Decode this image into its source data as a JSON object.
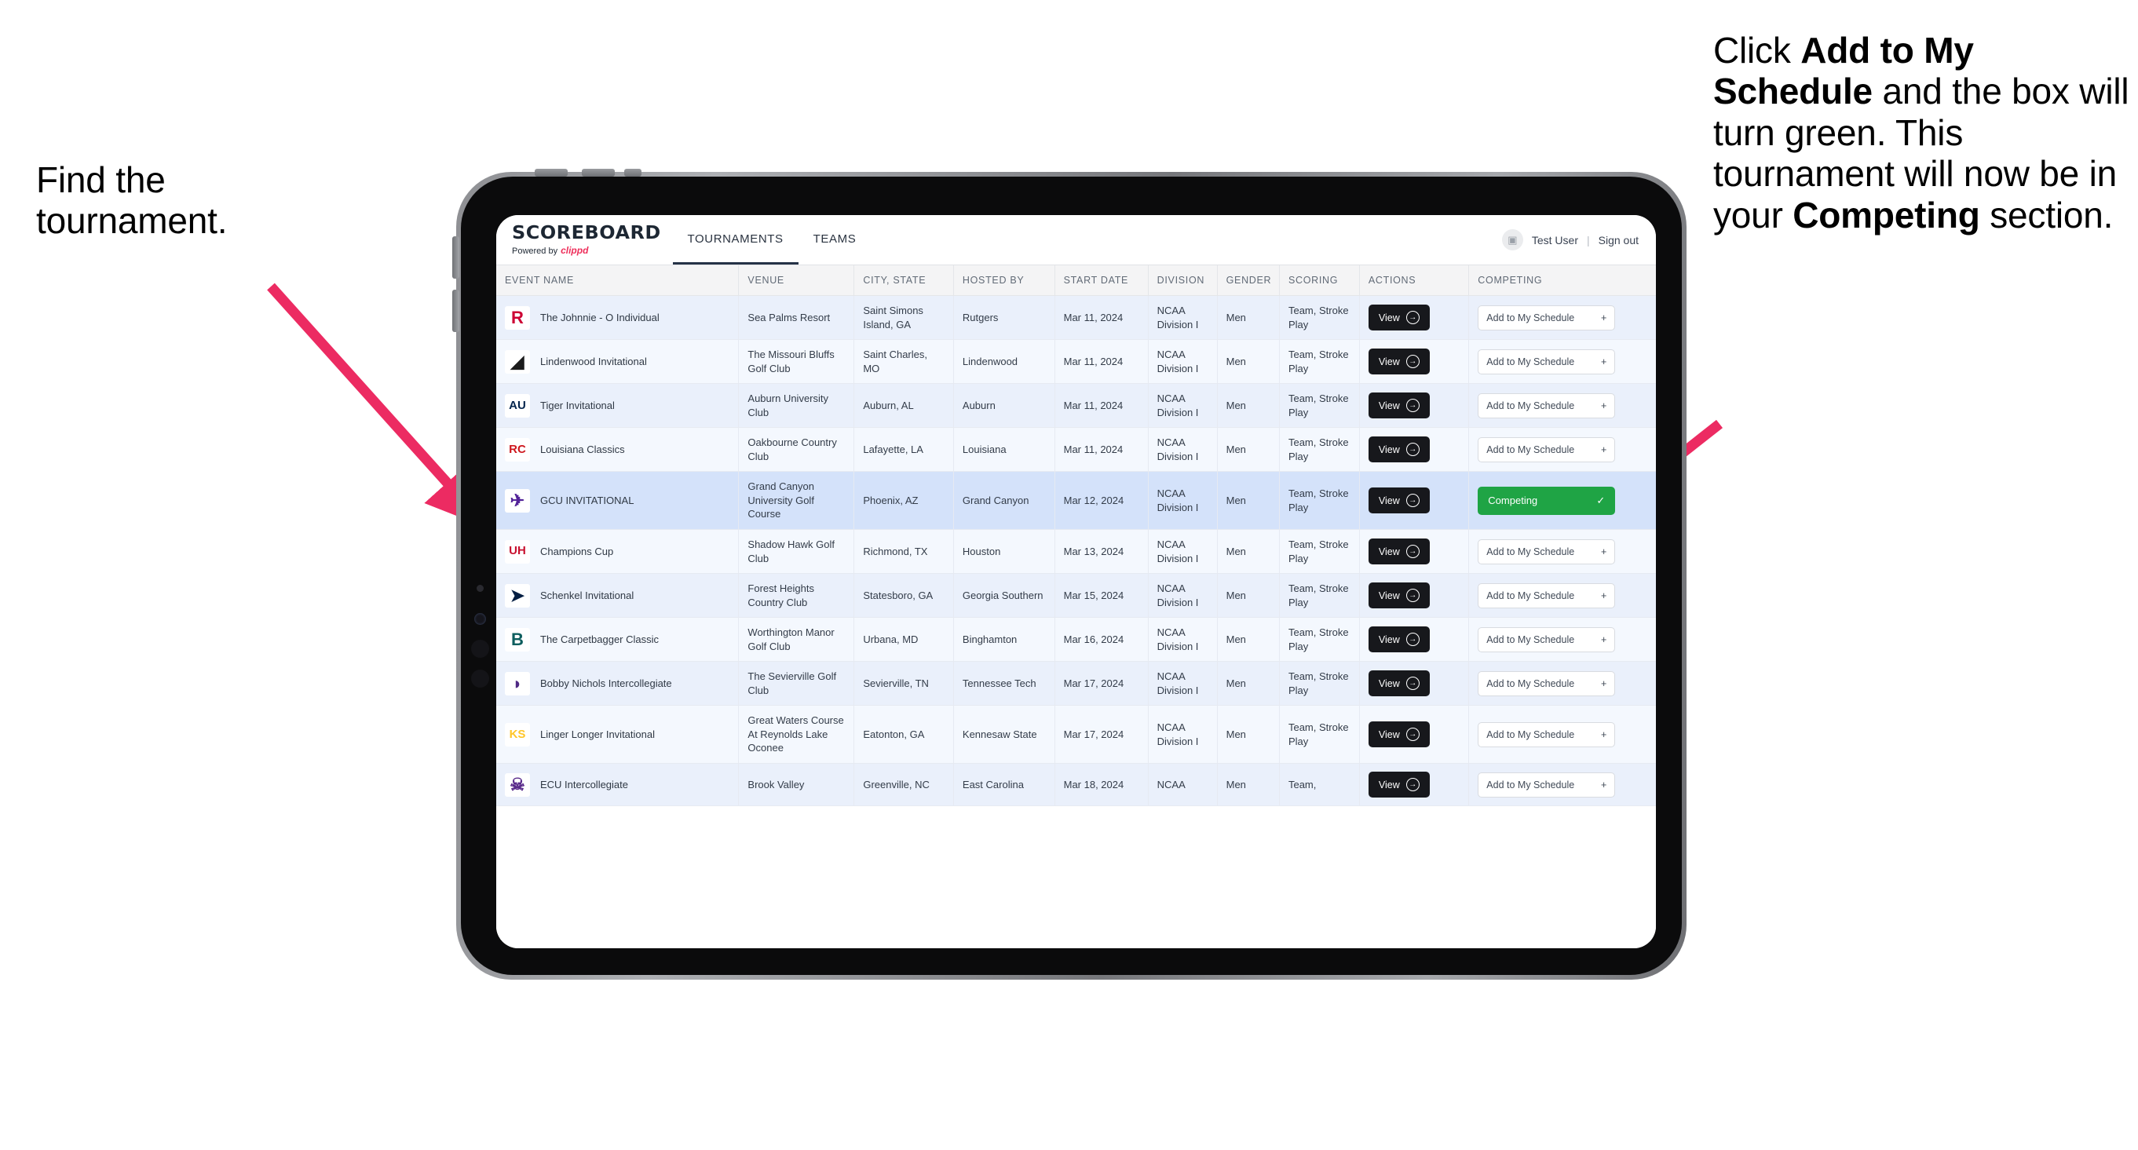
{
  "annotations": {
    "left": {
      "line1": "Find the",
      "line2": "tournament."
    },
    "right": {
      "p1": "Click ",
      "b1": "Add to My Schedule",
      "p2": " and the box will turn green. This tournament will now be in your ",
      "b2": "Competing",
      "p3": " section."
    },
    "arrow_color": "#ec2b62"
  },
  "app": {
    "brand": {
      "title": "SCOREBOARD",
      "powered_by": "Powered by",
      "partner": "clippd"
    },
    "nav_tabs": [
      {
        "label": "TOURNAMENTS",
        "active": true
      },
      {
        "label": "TEAMS",
        "active": false
      }
    ],
    "account": {
      "avatar_icon": "user-avatar-icon",
      "user": "Test User",
      "separator": "|",
      "sign_out": "Sign out"
    }
  },
  "table": {
    "columns": [
      "EVENT NAME",
      "VENUE",
      "CITY, STATE",
      "HOSTED BY",
      "START DATE",
      "DIVISION",
      "GENDER",
      "SCORING",
      "ACTIONS",
      "COMPETING"
    ],
    "action_label": "View",
    "add_label": "Add to My Schedule",
    "add_icon": "plus-icon",
    "competing_label": "Competing",
    "competing_icon": "check-icon",
    "view_icon": "arrow-right-circle-icon",
    "competing_color": "#1fa445",
    "rows": [
      {
        "event": "The Johnnie - O Individual",
        "venue": "Sea Palms Resort",
        "city": "Saint Simons Island, GA",
        "host": "Rutgers",
        "date": "Mar 11, 2024",
        "division": "NCAA Division I",
        "gender": "Men",
        "scoring": "Team, Stroke Play",
        "competing": false,
        "logo": {
          "name": "rutgers-logo",
          "glyph": "R",
          "fg": "#cc0033",
          "bg": "#ffffff"
        }
      },
      {
        "event": "Lindenwood Invitational",
        "venue": "The Missouri Bluffs Golf Club",
        "city": "Saint Charles, MO",
        "host": "Lindenwood",
        "date": "Mar 11, 2024",
        "division": "NCAA Division I",
        "gender": "Men",
        "scoring": "Team, Stroke Play",
        "competing": false,
        "logo": {
          "name": "lindenwood-lions-logo",
          "glyph": "◢",
          "fg": "#1b1b1b",
          "bg": "#ffffff"
        }
      },
      {
        "event": "Tiger Invitational",
        "venue": "Auburn University Club",
        "city": "Auburn, AL",
        "host": "Auburn",
        "date": "Mar 11, 2024",
        "division": "NCAA Division I",
        "gender": "Men",
        "scoring": "Team, Stroke Play",
        "competing": false,
        "logo": {
          "name": "auburn-logo",
          "glyph": "AU",
          "fg": "#03244d",
          "bg": "#ffffff"
        }
      },
      {
        "event": "Louisiana Classics",
        "venue": "Oakbourne Country Club",
        "city": "Lafayette, LA",
        "host": "Louisiana",
        "date": "Mar 11, 2024",
        "division": "NCAA Division I",
        "gender": "Men",
        "scoring": "Team, Stroke Play",
        "competing": false,
        "logo": {
          "name": "ragin-cajuns-logo",
          "glyph": "RC",
          "fg": "#ce181e",
          "bg": "#ffffff"
        }
      },
      {
        "event": "GCU INVITATIONAL",
        "venue": "Grand Canyon University Golf Course",
        "city": "Phoenix, AZ",
        "host": "Grand Canyon",
        "date": "Mar 12, 2024",
        "division": "NCAA Division I",
        "gender": "Men",
        "scoring": "Team, Stroke Play",
        "competing": true,
        "selected": true,
        "logo": {
          "name": "grand-canyon-lopes-logo",
          "glyph": "✈",
          "fg": "#522398",
          "bg": "#ffffff"
        }
      },
      {
        "event": "Champions Cup",
        "venue": "Shadow Hawk Golf Club",
        "city": "Richmond, TX",
        "host": "Houston",
        "date": "Mar 13, 2024",
        "division": "NCAA Division I",
        "gender": "Men",
        "scoring": "Team, Stroke Play",
        "competing": false,
        "logo": {
          "name": "houston-cougars-logo",
          "glyph": "UH",
          "fg": "#c8102e",
          "bg": "#ffffff"
        }
      },
      {
        "event": "Schenkel Invitational",
        "venue": "Forest Heights Country Club",
        "city": "Statesboro, GA",
        "host": "Georgia Southern",
        "date": "Mar 15, 2024",
        "division": "NCAA Division I",
        "gender": "Men",
        "scoring": "Team, Stroke Play",
        "competing": false,
        "logo": {
          "name": "georgia-southern-eagles-logo",
          "glyph": "➤",
          "fg": "#041e42",
          "bg": "#ffffff"
        }
      },
      {
        "event": "The Carpetbagger Classic",
        "venue": "Worthington Manor Golf Club",
        "city": "Urbana, MD",
        "host": "Binghamton",
        "date": "Mar 16, 2024",
        "division": "NCAA Division I",
        "gender": "Men",
        "scoring": "Team, Stroke Play",
        "competing": false,
        "logo": {
          "name": "binghamton-bearcats-logo",
          "glyph": "B",
          "fg": "#0d5e5e",
          "bg": "#ffffff"
        }
      },
      {
        "event": "Bobby Nichols Intercollegiate",
        "venue": "The Sevierville Golf Club",
        "city": "Sevierville, TN",
        "host": "Tennessee Tech",
        "date": "Mar 17, 2024",
        "division": "NCAA Division I",
        "gender": "Men",
        "scoring": "Team, Stroke Play",
        "competing": false,
        "logo": {
          "name": "tennessee-tech-eagles-logo",
          "glyph": "◗",
          "fg": "#4f2984",
          "bg": "#ffffff"
        }
      },
      {
        "event": "Linger Longer Invitational",
        "venue": "Great Waters Course At Reynolds Lake Oconee",
        "city": "Eatonton, GA",
        "host": "Kennesaw State",
        "date": "Mar 17, 2024",
        "division": "NCAA Division I",
        "gender": "Men",
        "scoring": "Team, Stroke Play",
        "competing": false,
        "logo": {
          "name": "kennesaw-state-owls-logo",
          "glyph": "KS",
          "fg": "#ffc629",
          "bg": "#ffffff"
        }
      },
      {
        "event": "ECU Intercollegiate",
        "venue": "Brook Valley",
        "city": "Greenville, NC",
        "host": "East Carolina",
        "date": "Mar 18, 2024",
        "division": "NCAA",
        "gender": "Men",
        "scoring": "Team,",
        "competing": false,
        "partial": true,
        "logo": {
          "name": "east-carolina-pirates-logo",
          "glyph": "☠",
          "fg": "#592a8a",
          "bg": "#ffffff"
        }
      }
    ]
  }
}
